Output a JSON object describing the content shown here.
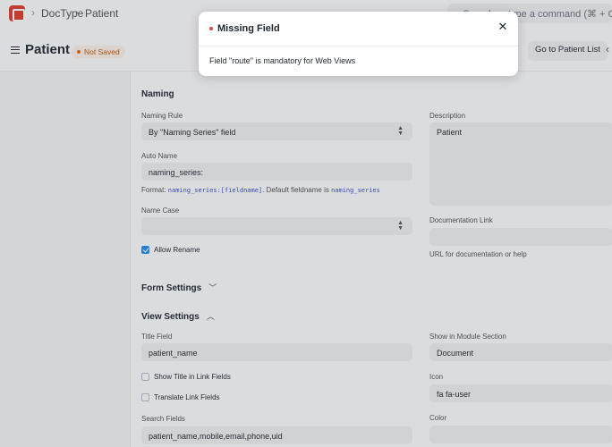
{
  "breadcrumb": {
    "items": [
      "DocType",
      "Patient"
    ]
  },
  "search": {
    "text": "Search or type a command (⌘ + G)"
  },
  "page": {
    "title": "Patient",
    "status": "Not Saved",
    "list_button": "Go to Patient List"
  },
  "naming": {
    "section_title": "Naming",
    "naming_rule_label": "Naming Rule",
    "naming_rule_value": "By \"Naming Series\" field",
    "auto_name_label": "Auto Name",
    "auto_name_value": "naming_series:",
    "format_prefix": "Format: ",
    "format_code": "naming_series:[fieldname]",
    "format_middle": ". Default fieldname is ",
    "format_default": "naming_series",
    "name_case_label": "Name Case",
    "name_case_value": "",
    "allow_rename_label": "Allow Rename",
    "description_label": "Description",
    "description_value": "Patient",
    "doc_link_label": "Documentation Link",
    "doc_link_value": "",
    "doc_link_help": "URL for documentation or help"
  },
  "form_settings": {
    "title": "Form Settings"
  },
  "view_settings": {
    "title": "View Settings",
    "title_field_label": "Title Field",
    "title_field_value": "patient_name",
    "show_title_label": "Show Title in Link Fields",
    "translate_label": "Translate Link Fields",
    "search_fields_label": "Search Fields",
    "search_fields_value": "patient_name,mobile,email,phone,uid",
    "module_section_label": "Show in Module Section",
    "module_section_value": "Document",
    "icon_label": "Icon",
    "icon_value": "fa fa-user",
    "color_label": "Color",
    "color_value": ""
  },
  "modal": {
    "title": "Missing Field",
    "message": "Field \"route\" is mandatory for Web Views"
  },
  "colors": {
    "accent": "#2490ef",
    "brand": "#e03e2d",
    "warning": "#e86c13",
    "error": "#e24c4c"
  }
}
